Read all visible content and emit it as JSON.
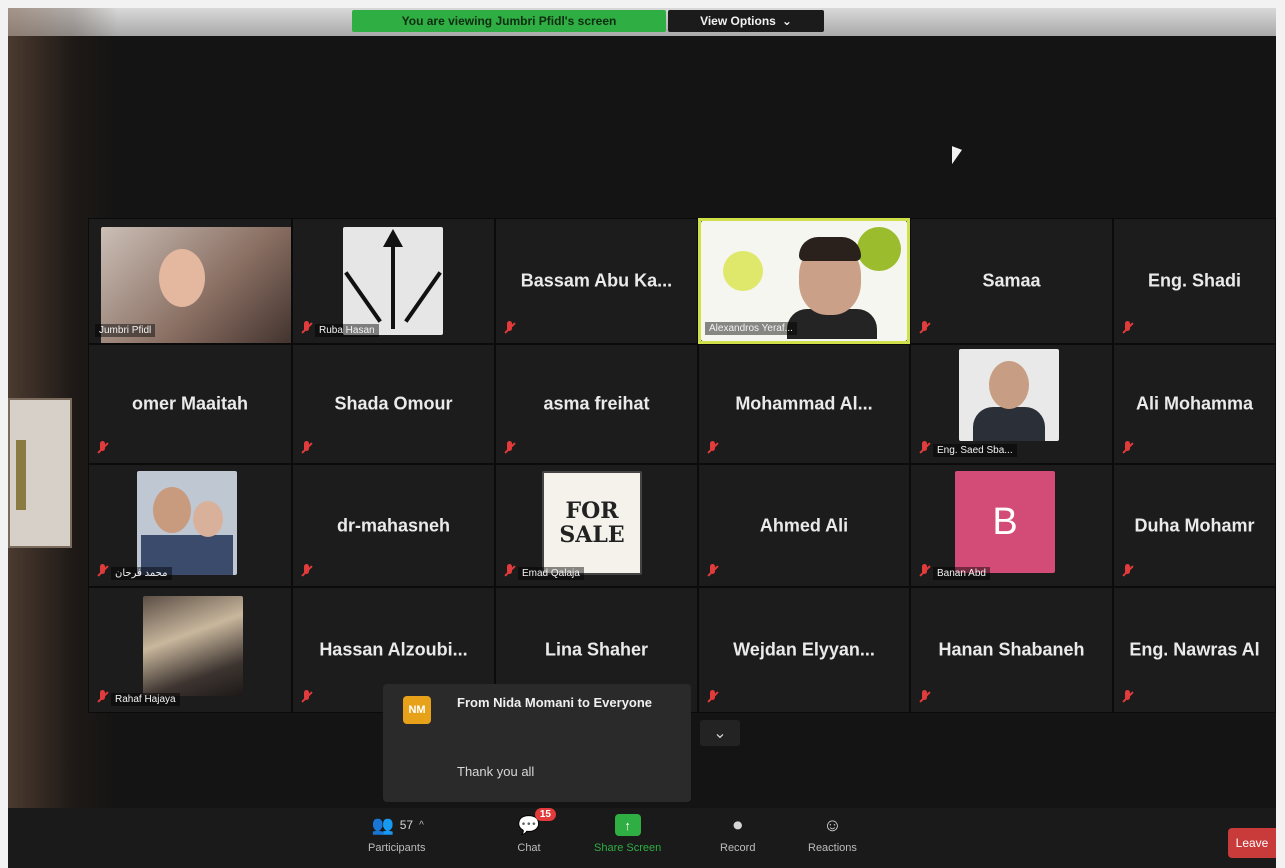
{
  "banner": {
    "share_text": "You are viewing Jumbri Pfidl's screen",
    "view_options": "View Options",
    "view_options_caret": "⌄"
  },
  "participants": [
    {
      "row": 1,
      "col": 1,
      "type": "video",
      "label": "Jumbri Pfidl"
    },
    {
      "row": 1,
      "col": 2,
      "type": "video",
      "label": "Ruba Hasan"
    },
    {
      "row": 1,
      "col": 3,
      "type": "name",
      "name": "Bassam  Abu  Ka..."
    },
    {
      "row": 1,
      "col": 4,
      "type": "video",
      "label": "Alexandros Yeraf...",
      "active": true
    },
    {
      "row": 1,
      "col": 5,
      "type": "name",
      "name": "Samaa"
    },
    {
      "row": 1,
      "col": 6,
      "type": "name",
      "name": "Eng. Shadi"
    },
    {
      "row": 2,
      "col": 1,
      "type": "name",
      "name": "omer Maaitah"
    },
    {
      "row": 2,
      "col": 2,
      "type": "name",
      "name": "Shada Omour"
    },
    {
      "row": 2,
      "col": 3,
      "type": "name",
      "name": "asma freihat"
    },
    {
      "row": 2,
      "col": 4,
      "type": "name",
      "name": "Mohammad  Al..."
    },
    {
      "row": 2,
      "col": 5,
      "type": "video",
      "label": "Eng. Saed Sba..."
    },
    {
      "row": 2,
      "col": 6,
      "type": "name",
      "name": "Ali  Mohamma"
    },
    {
      "row": 3,
      "col": 1,
      "type": "video",
      "label": "محمد فرحان"
    },
    {
      "row": 3,
      "col": 2,
      "type": "name",
      "name": "dr-mahasneh"
    },
    {
      "row": 3,
      "col": 3,
      "type": "video",
      "label": "Emad Qalaja"
    },
    {
      "row": 3,
      "col": 4,
      "type": "name",
      "name": "Ahmed Ali"
    },
    {
      "row": 3,
      "col": 5,
      "type": "video",
      "label": "Banan Abd"
    },
    {
      "row": 3,
      "col": 6,
      "type": "name",
      "name": "Duha  Mohamr"
    },
    {
      "row": 4,
      "col": 1,
      "type": "video",
      "label": "Rahaf Hajaya"
    },
    {
      "row": 4,
      "col": 2,
      "type": "name",
      "name": "Hassan  Alzoubi..."
    },
    {
      "row": 4,
      "col": 3,
      "type": "name",
      "name": "Lina Shaher"
    },
    {
      "row": 4,
      "col": 4,
      "type": "name",
      "name": "Wejdan  Elyyan..."
    },
    {
      "row": 4,
      "col": 5,
      "type": "name",
      "name": "Hanan Shabaneh"
    },
    {
      "row": 4,
      "col": 6,
      "type": "name",
      "name": "Eng.  Nawras  Al"
    }
  ],
  "tile_images": {
    "for_sale_line1": "FOR",
    "for_sale_line2": "SALE",
    "avatar_letter": "B"
  },
  "chat_popup": {
    "avatar_initials": "NM",
    "from": "From Nida Momani to Everyone",
    "message": "Thank you all",
    "collapse_icon": "⌄"
  },
  "toolbar": {
    "participants_label": "Participants",
    "participants_count": "57",
    "participants_caret": "^",
    "chat_label": "Chat",
    "chat_badge": "15",
    "share_label": "Share Screen",
    "share_icon": "↑",
    "record_label": "Record",
    "reactions_label": "Reactions",
    "leave_label": "Leave"
  },
  "colors": {
    "share_green": "#2fae43",
    "active_speaker": "#cfe04a",
    "mute_red": "#e23b3b",
    "avatar_pink": "#d34b77",
    "chat_avatar": "#e8a21a"
  }
}
